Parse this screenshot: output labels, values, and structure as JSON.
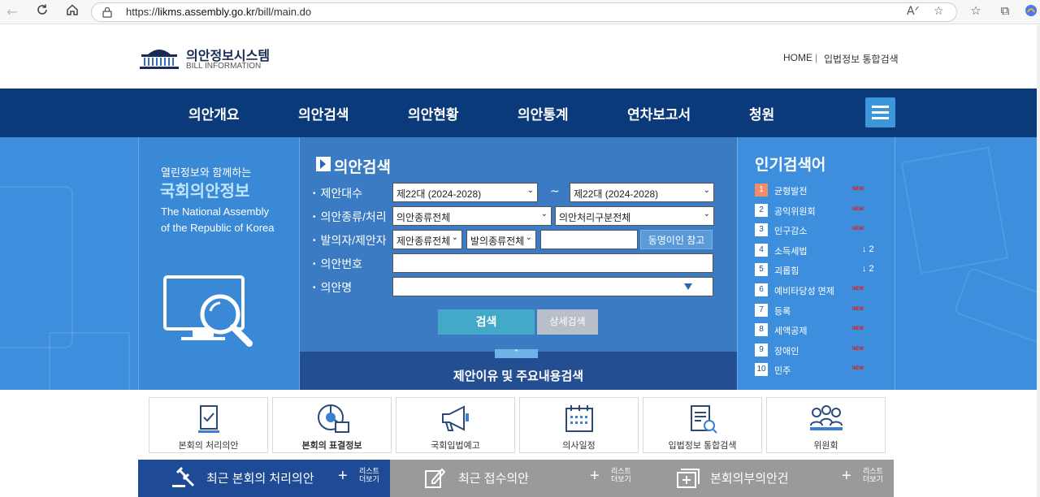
{
  "browser": {
    "url_prefix": "https://",
    "url_host": "likms.assembly.go.kr",
    "url_path": "/bill/main.do"
  },
  "header": {
    "logo_title": "의안정보시스템",
    "logo_sub": "BILL INFORMATION",
    "home_link": "HOME",
    "separator": "|",
    "integrated_search_link": "입법정보 통합검색"
  },
  "gnb": {
    "items": [
      {
        "label": "의안개요"
      },
      {
        "label": "의안검색"
      },
      {
        "label": "의안현황"
      },
      {
        "label": "의안통계"
      },
      {
        "label": "연차보고서"
      },
      {
        "label": "청원"
      }
    ]
  },
  "intro": {
    "eyebrow": "열린정보와 함께하는",
    "title": "국회의안정보",
    "en_line1": "The National Assembly",
    "en_line2": "of the Republic of Korea"
  },
  "search": {
    "title": "의안검색",
    "labels": {
      "session": "제안대수",
      "type": "의안종류/처리",
      "proposer": "발의자/제안자",
      "bill_no": "의안번호",
      "bill_name": "의안명"
    },
    "session_from": "제22대 (2024-2028)",
    "session_to": "제22대 (2024-2028)",
    "tilde": "~",
    "bill_type": "의안종류전체",
    "process_type": "의안처리구분전체",
    "proposer_type": "제안종류전체",
    "proposer_kind": "발의종류전체",
    "proposer_name": "",
    "same_name_button": "동명이인 참고",
    "bill_no_value": "",
    "bill_name_value": "",
    "search_button": "검색",
    "detail_button": "상세검색",
    "reason_search": "제안이유 및 주요내용검색"
  },
  "popular": {
    "title": "인기검색어",
    "new_badge": "NEW",
    "items": [
      {
        "rank": "1",
        "term": "균형발전",
        "change": "NEW"
      },
      {
        "rank": "2",
        "term": "공익위원회",
        "change": "NEW"
      },
      {
        "rank": "3",
        "term": "인구감소",
        "change": "NEW"
      },
      {
        "rank": "4",
        "term": "소득세법",
        "change": "2"
      },
      {
        "rank": "5",
        "term": "괴롭힘",
        "change": "2"
      },
      {
        "rank": "6",
        "term": "예비타당성 면제",
        "change": "NEW"
      },
      {
        "rank": "7",
        "term": "등록",
        "change": "NEW"
      },
      {
        "rank": "8",
        "term": "세액공제",
        "change": "NEW"
      },
      {
        "rank": "9",
        "term": "장애인",
        "change": "NEW"
      },
      {
        "rank": "10",
        "term": "민주",
        "change": "NEW"
      }
    ]
  },
  "quick_links": [
    {
      "label": "본회의 처리의안",
      "icon": "document-check-icon"
    },
    {
      "label": "본회의 표결정보",
      "icon": "pie-chart-icon"
    },
    {
      "label": "국회입법예고",
      "icon": "megaphone-icon"
    },
    {
      "label": "의사일정",
      "icon": "calendar-icon"
    },
    {
      "label": "입법정보 통합검색",
      "icon": "document-search-icon"
    },
    {
      "label": "위원회",
      "icon": "people-icon"
    }
  ],
  "bottom_tabs": [
    {
      "label": "최근 본회의 처리의안",
      "more": "리스트\n더보기",
      "color": "#1f4a96"
    },
    {
      "label": "최근 접수의안",
      "more": "리스트\n더보기",
      "color": "#9a9a9a"
    },
    {
      "label": "본회의부의안건",
      "more": "리스트\n더보기",
      "color": "#9a9a9a"
    }
  ],
  "colors": {
    "gnb": "#0a3a7a",
    "visual": "#3d8fdd",
    "accent": "#44a8c8",
    "hot_rank": "#f28c6a"
  }
}
